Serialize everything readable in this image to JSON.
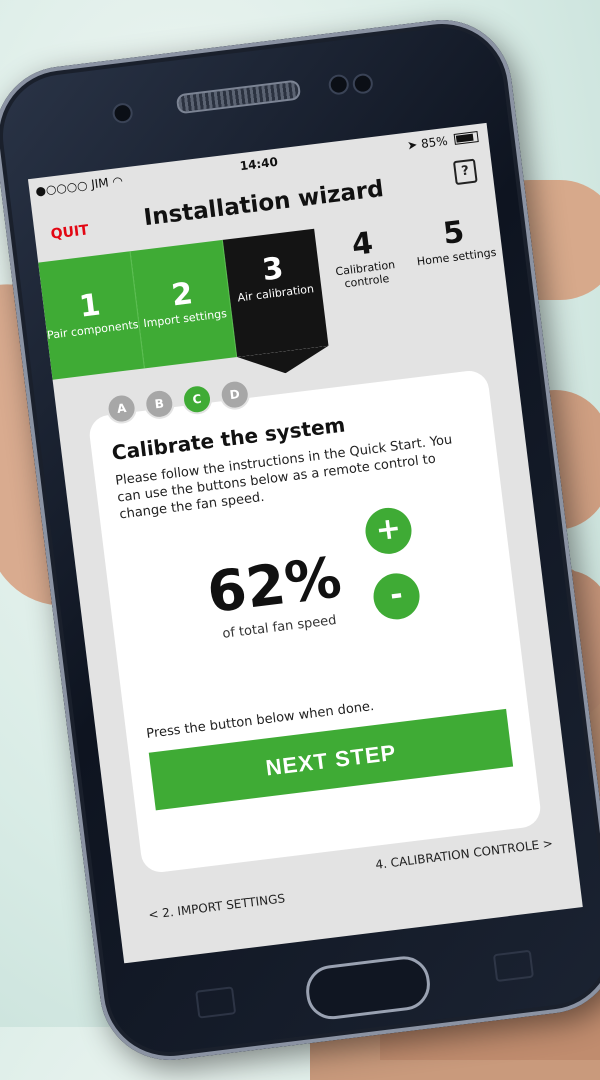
{
  "status": {
    "carrier": "●○○○○ JIM",
    "wifi_icon": "wifi-icon",
    "time": "14:40",
    "battery": "85%",
    "location_icon": "location-icon"
  },
  "header": {
    "quit": "QUIT",
    "title": "Installation wizard",
    "help": "?"
  },
  "steps": [
    {
      "num": "1",
      "label": "Pair components",
      "state": "done"
    },
    {
      "num": "2",
      "label": "Import settings",
      "state": "done"
    },
    {
      "num": "3",
      "label": "Air calibration",
      "state": "current"
    },
    {
      "num": "4",
      "label": "Calibration controle",
      "state": "todo"
    },
    {
      "num": "5",
      "label": "Home settings",
      "state": "todo"
    }
  ],
  "substeps": [
    {
      "label": "A",
      "active": false
    },
    {
      "label": "B",
      "active": false
    },
    {
      "label": "C",
      "active": true
    },
    {
      "label": "D",
      "active": false
    }
  ],
  "card": {
    "title": "Calibrate the system",
    "instructions": "Please follow the instructions in the Quick Start. You can use the buttons below as a remote control to change the fan speed.",
    "fan_speed": "62%",
    "fan_speed_caption": "of total fan speed",
    "plus": "+",
    "minus": "-",
    "press_text": "Press the button below when done.",
    "next_button": "NEXT STEP"
  },
  "footer_nav": {
    "prev": "<  2. IMPORT SETTINGS",
    "next": "4. CALIBRATION CONTROLE  >"
  },
  "colors": {
    "accent_green": "#3fab35",
    "quit_red": "#e30613",
    "current_step": "#141414"
  }
}
